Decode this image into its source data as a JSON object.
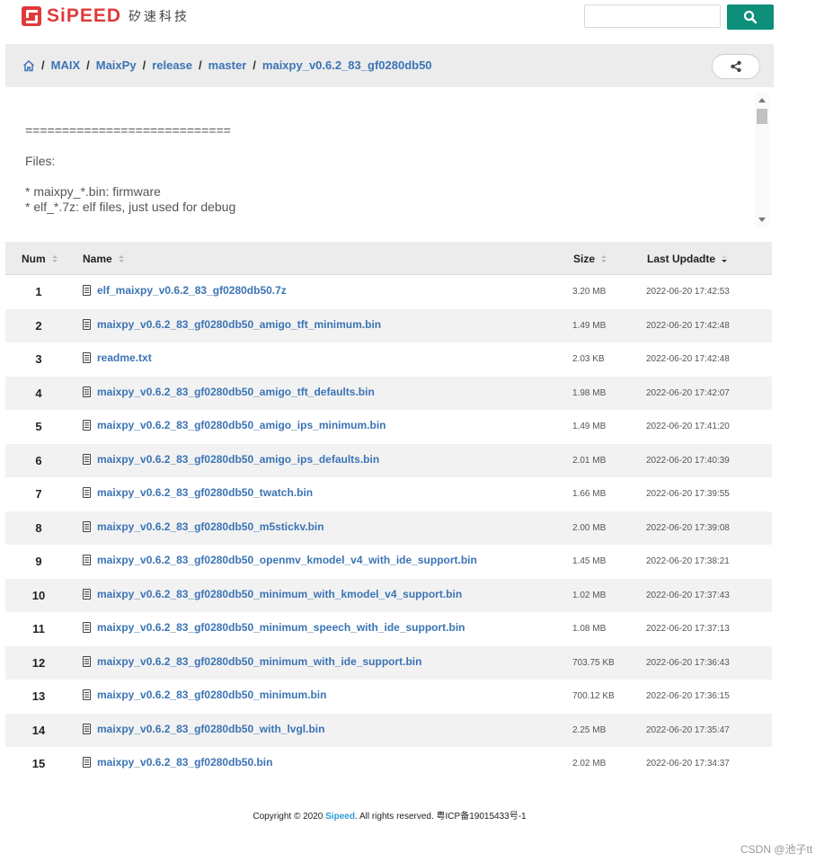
{
  "header": {
    "brand": "SiPEED",
    "brand_sub": "矽速科技",
    "search_placeholder": "",
    "search_icon": "search-icon"
  },
  "breadcrumb": {
    "home_icon": "home-icon",
    "items": [
      "MAIX",
      "MaixPy",
      "release",
      "master",
      "maixpy_v0.6.2_83_gf0280db50"
    ],
    "share_icon": "share-icon"
  },
  "readme": {
    "text": "============================\n\nFiles:\n\n* maixpy_*.bin: firmware\n* elf_*.7z: elf files, just used for debug"
  },
  "table": {
    "columns": {
      "num": "Num",
      "name": "Name",
      "size": "Size",
      "date": "Last Updadte"
    },
    "rows": [
      {
        "num": "1",
        "name": "elf_maixpy_v0.6.2_83_gf0280db50.7z",
        "size": "3.20 MB",
        "date": "2022-06-20 17:42:53"
      },
      {
        "num": "2",
        "name": "maixpy_v0.6.2_83_gf0280db50_amigo_tft_minimum.bin",
        "size": "1.49 MB",
        "date": "2022-06-20 17:42:48"
      },
      {
        "num": "3",
        "name": "readme.txt",
        "size": "2.03 KB",
        "date": "2022-06-20 17:42:48"
      },
      {
        "num": "4",
        "name": "maixpy_v0.6.2_83_gf0280db50_amigo_tft_defaults.bin",
        "size": "1.98 MB",
        "date": "2022-06-20 17:42:07"
      },
      {
        "num": "5",
        "name": "maixpy_v0.6.2_83_gf0280db50_amigo_ips_minimum.bin",
        "size": "1.49 MB",
        "date": "2022-06-20 17:41:20"
      },
      {
        "num": "6",
        "name": "maixpy_v0.6.2_83_gf0280db50_amigo_ips_defaults.bin",
        "size": "2.01 MB",
        "date": "2022-06-20 17:40:39"
      },
      {
        "num": "7",
        "name": "maixpy_v0.6.2_83_gf0280db50_twatch.bin",
        "size": "1.66 MB",
        "date": "2022-06-20 17:39:55"
      },
      {
        "num": "8",
        "name": "maixpy_v0.6.2_83_gf0280db50_m5stickv.bin",
        "size": "2.00 MB",
        "date": "2022-06-20 17:39:08"
      },
      {
        "num": "9",
        "name": "maixpy_v0.6.2_83_gf0280db50_openmv_kmodel_v4_with_ide_support.bin",
        "size": "1.45 MB",
        "date": "2022-06-20 17:38:21"
      },
      {
        "num": "10",
        "name": "maixpy_v0.6.2_83_gf0280db50_minimum_with_kmodel_v4_support.bin",
        "size": "1.02 MB",
        "date": "2022-06-20 17:37:43"
      },
      {
        "num": "11",
        "name": "maixpy_v0.6.2_83_gf0280db50_minimum_speech_with_ide_support.bin",
        "size": "1.08 MB",
        "date": "2022-06-20 17:37:13"
      },
      {
        "num": "12",
        "name": "maixpy_v0.6.2_83_gf0280db50_minimum_with_ide_support.bin",
        "size": "703.75 KB",
        "date": "2022-06-20 17:36:43"
      },
      {
        "num": "13",
        "name": "maixpy_v0.6.2_83_gf0280db50_minimum.bin",
        "size": "700.12 KB",
        "date": "2022-06-20 17:36:15"
      },
      {
        "num": "14",
        "name": "maixpy_v0.6.2_83_gf0280db50_with_lvgl.bin",
        "size": "2.25 MB",
        "date": "2022-06-20 17:35:47"
      },
      {
        "num": "15",
        "name": "maixpy_v0.6.2_83_gf0280db50.bin",
        "size": "2.02 MB",
        "date": "2022-06-20 17:34:37"
      }
    ]
  },
  "footer": {
    "prefix": "Copyright © 2020 ",
    "link": "Sipeed",
    "suffix": ". All rights reserved. 粤ICP备19015433号-1"
  },
  "watermark": "CSDN @池子tt",
  "colors": {
    "brand": "#e03a3a",
    "accent": "#0d8f7a",
    "link": "#3b74b5"
  }
}
